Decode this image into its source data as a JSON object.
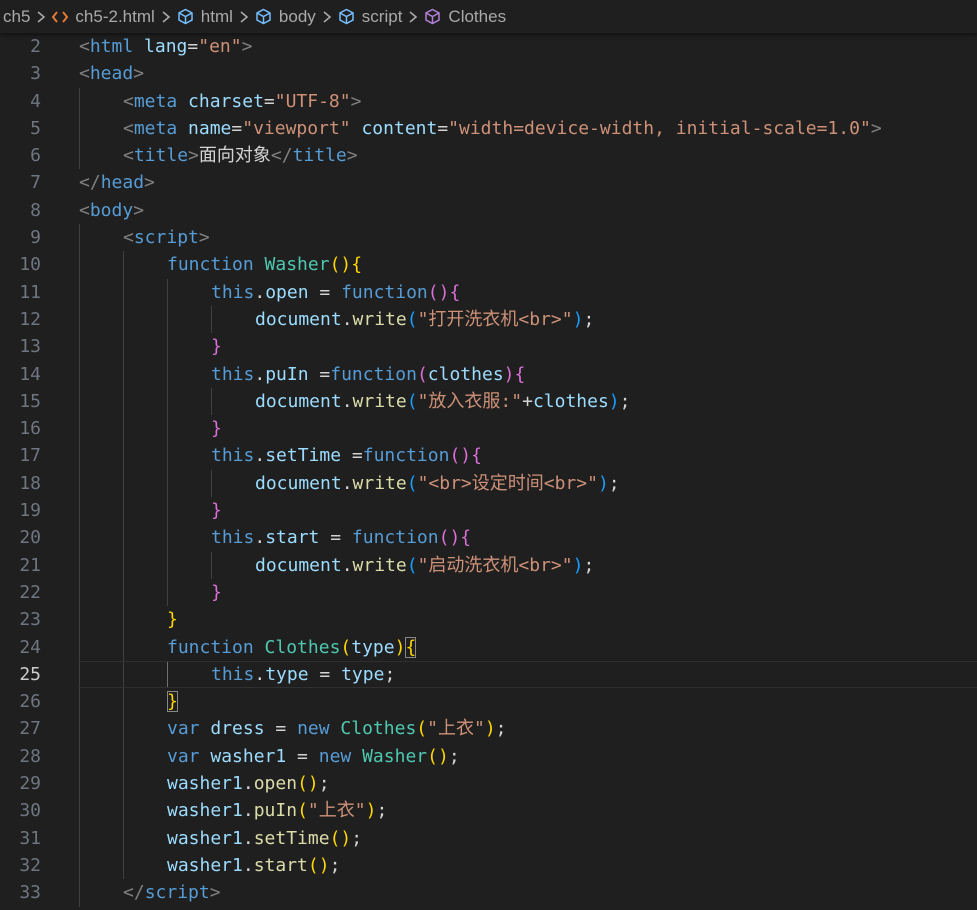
{
  "breadcrumb": {
    "items": [
      {
        "label": "ch5",
        "icon": "folder"
      },
      {
        "label": "ch5-2.html",
        "icon": "html-file-icon",
        "icon_color": "#e37933"
      },
      {
        "label": "html",
        "icon": "element-icon",
        "icon_color": "#75beff"
      },
      {
        "label": "body",
        "icon": "element-icon",
        "icon_color": "#75beff"
      },
      {
        "label": "script",
        "icon": "element-icon",
        "icon_color": "#75beff"
      },
      {
        "label": "Clothes",
        "icon": "class-icon",
        "icon_color": "#b180d7"
      }
    ],
    "separator_icon": "chevron-right-icon"
  },
  "editor": {
    "theme": "Dark Modern",
    "current_line": 25,
    "lines": [
      {
        "n": "2",
        "indent": 0,
        "tokens": [
          [
            "tag_punc",
            "<"
          ],
          [
            "tag",
            "html"
          ],
          [
            "text",
            " "
          ],
          [
            "attr",
            "lang"
          ],
          [
            "text",
            "="
          ],
          [
            "str",
            "\"en\""
          ],
          [
            "tag_punc",
            ">"
          ]
        ]
      },
      {
        "n": "3",
        "indent": 0,
        "tokens": [
          [
            "tag_punc",
            "<"
          ],
          [
            "tag",
            "head"
          ],
          [
            "tag_punc",
            ">"
          ]
        ]
      },
      {
        "n": "4",
        "indent": 1,
        "tokens": [
          [
            "tag_punc",
            "<"
          ],
          [
            "tag",
            "meta"
          ],
          [
            "text",
            " "
          ],
          [
            "attr",
            "charset"
          ],
          [
            "text",
            "="
          ],
          [
            "str",
            "\"UTF-8\""
          ],
          [
            "tag_punc",
            ">"
          ]
        ]
      },
      {
        "n": "5",
        "indent": 1,
        "tokens": [
          [
            "tag_punc",
            "<"
          ],
          [
            "tag",
            "meta"
          ],
          [
            "text",
            " "
          ],
          [
            "attr",
            "name"
          ],
          [
            "text",
            "="
          ],
          [
            "str",
            "\"viewport\""
          ],
          [
            "text",
            " "
          ],
          [
            "attr",
            "content"
          ],
          [
            "text",
            "="
          ],
          [
            "str",
            "\"width=device-width, initial-scale=1.0\""
          ],
          [
            "tag_punc",
            ">"
          ]
        ]
      },
      {
        "n": "6",
        "indent": 1,
        "tokens": [
          [
            "tag_punc",
            "<"
          ],
          [
            "tag",
            "title"
          ],
          [
            "tag_punc",
            ">"
          ],
          [
            "text",
            "面向对象"
          ],
          [
            "tag_punc",
            "</"
          ],
          [
            "tag",
            "title"
          ],
          [
            "tag_punc",
            ">"
          ]
        ]
      },
      {
        "n": "7",
        "indent": 0,
        "tokens": [
          [
            "tag_punc",
            "</"
          ],
          [
            "tag",
            "head"
          ],
          [
            "tag_punc",
            ">"
          ]
        ]
      },
      {
        "n": "8",
        "indent": 0,
        "tokens": [
          [
            "tag_punc",
            "<"
          ],
          [
            "tag",
            "body"
          ],
          [
            "tag_punc",
            ">"
          ]
        ]
      },
      {
        "n": "9",
        "indent": 1,
        "tokens": [
          [
            "tag_punc",
            "<"
          ],
          [
            "tag",
            "script"
          ],
          [
            "tag_punc",
            ">"
          ]
        ]
      },
      {
        "n": "10",
        "indent": 2,
        "tokens": [
          [
            "kw",
            "function"
          ],
          [
            "text",
            " "
          ],
          [
            "fn",
            "Washer"
          ],
          [
            "br1",
            "()"
          ],
          [
            "br1",
            "{"
          ]
        ]
      },
      {
        "n": "11",
        "indent": 3,
        "tokens": [
          [
            "kw",
            "this"
          ],
          [
            "text",
            "."
          ],
          [
            "var",
            "open"
          ],
          [
            "text",
            " = "
          ],
          [
            "kw",
            "function"
          ],
          [
            "br2",
            "()"
          ],
          [
            "br2",
            "{"
          ]
        ]
      },
      {
        "n": "12",
        "indent": 4,
        "tokens": [
          [
            "var",
            "document"
          ],
          [
            "text",
            "."
          ],
          [
            "call",
            "write"
          ],
          [
            "br3",
            "("
          ],
          [
            "str",
            "\"打开洗衣机<br>\""
          ],
          [
            "br3",
            ")"
          ],
          [
            "text",
            ";"
          ]
        ]
      },
      {
        "n": "13",
        "indent": 3,
        "tokens": [
          [
            "br2",
            "}"
          ]
        ]
      },
      {
        "n": "14",
        "indent": 3,
        "tokens": [
          [
            "kw",
            "this"
          ],
          [
            "text",
            "."
          ],
          [
            "var",
            "puIn"
          ],
          [
            "text",
            " ="
          ],
          [
            "kw",
            "function"
          ],
          [
            "br2",
            "("
          ],
          [
            "var",
            "clothes"
          ],
          [
            "br2",
            ")"
          ],
          [
            "br2",
            "{"
          ]
        ]
      },
      {
        "n": "15",
        "indent": 4,
        "tokens": [
          [
            "var",
            "document"
          ],
          [
            "text",
            "."
          ],
          [
            "call",
            "write"
          ],
          [
            "br3",
            "("
          ],
          [
            "str",
            "\"放入衣服:\""
          ],
          [
            "text",
            "+"
          ],
          [
            "var",
            "clothes"
          ],
          [
            "br3",
            ")"
          ],
          [
            "text",
            ";"
          ]
        ]
      },
      {
        "n": "16",
        "indent": 3,
        "tokens": [
          [
            "br2",
            "}"
          ]
        ]
      },
      {
        "n": "17",
        "indent": 3,
        "tokens": [
          [
            "kw",
            "this"
          ],
          [
            "text",
            "."
          ],
          [
            "var",
            "setTime"
          ],
          [
            "text",
            " ="
          ],
          [
            "kw",
            "function"
          ],
          [
            "br2",
            "()"
          ],
          [
            "br2",
            "{"
          ]
        ]
      },
      {
        "n": "18",
        "indent": 4,
        "tokens": [
          [
            "var",
            "document"
          ],
          [
            "text",
            "."
          ],
          [
            "call",
            "write"
          ],
          [
            "br3",
            "("
          ],
          [
            "str",
            "\"<br>设定时间<br>\""
          ],
          [
            "br3",
            ")"
          ],
          [
            "text",
            ";"
          ]
        ]
      },
      {
        "n": "19",
        "indent": 3,
        "tokens": [
          [
            "br2",
            "}"
          ]
        ]
      },
      {
        "n": "20",
        "indent": 3,
        "tokens": [
          [
            "kw",
            "this"
          ],
          [
            "text",
            "."
          ],
          [
            "var",
            "start"
          ],
          [
            "text",
            " = "
          ],
          [
            "kw",
            "function"
          ],
          [
            "br2",
            "()"
          ],
          [
            "br2",
            "{"
          ]
        ]
      },
      {
        "n": "21",
        "indent": 4,
        "tokens": [
          [
            "var",
            "document"
          ],
          [
            "text",
            "."
          ],
          [
            "call",
            "write"
          ],
          [
            "br3",
            "("
          ],
          [
            "str",
            "\"启动洗衣机<br>\""
          ],
          [
            "br3",
            ")"
          ],
          [
            "text",
            ";"
          ]
        ]
      },
      {
        "n": "22",
        "indent": 3,
        "tokens": [
          [
            "br2",
            "}"
          ]
        ]
      },
      {
        "n": "23",
        "indent": 2,
        "tokens": [
          [
            "br1",
            "}"
          ]
        ]
      },
      {
        "n": "24",
        "indent": 2,
        "tokens": [
          [
            "kw",
            "function"
          ],
          [
            "text",
            " "
          ],
          [
            "fn",
            "Clothes"
          ],
          [
            "br1",
            "("
          ],
          [
            "var",
            "type"
          ],
          [
            "br1",
            ")"
          ],
          [
            "br1_match",
            "{"
          ]
        ]
      },
      {
        "n": "25",
        "indent": 3,
        "tokens": [
          [
            "kw",
            "this"
          ],
          [
            "text",
            "."
          ],
          [
            "var",
            "type"
          ],
          [
            "text",
            " = "
          ],
          [
            "var",
            "type"
          ],
          [
            "text",
            ";"
          ]
        ]
      },
      {
        "n": "26",
        "indent": 2,
        "tokens": [
          [
            "br1_match",
            "}"
          ]
        ]
      },
      {
        "n": "27",
        "indent": 2,
        "tokens": [
          [
            "kw",
            "var"
          ],
          [
            "text",
            " "
          ],
          [
            "var",
            "dress"
          ],
          [
            "text",
            " = "
          ],
          [
            "kw",
            "new"
          ],
          [
            "text",
            " "
          ],
          [
            "fn",
            "Clothes"
          ],
          [
            "br1",
            "("
          ],
          [
            "str",
            "\"上衣\""
          ],
          [
            "br1",
            ")"
          ],
          [
            "text",
            ";"
          ]
        ]
      },
      {
        "n": "28",
        "indent": 2,
        "tokens": [
          [
            "kw",
            "var"
          ],
          [
            "text",
            " "
          ],
          [
            "var",
            "washer1"
          ],
          [
            "text",
            " = "
          ],
          [
            "kw",
            "new"
          ],
          [
            "text",
            " "
          ],
          [
            "fn",
            "Washer"
          ],
          [
            "br1",
            "()"
          ],
          [
            "text",
            ";"
          ]
        ]
      },
      {
        "n": "29",
        "indent": 2,
        "tokens": [
          [
            "var",
            "washer1"
          ],
          [
            "text",
            "."
          ],
          [
            "call",
            "open"
          ],
          [
            "br1",
            "()"
          ],
          [
            "text",
            ";"
          ]
        ]
      },
      {
        "n": "30",
        "indent": 2,
        "tokens": [
          [
            "var",
            "washer1"
          ],
          [
            "text",
            "."
          ],
          [
            "call",
            "puIn"
          ],
          [
            "br1",
            "("
          ],
          [
            "str",
            "\"上衣\""
          ],
          [
            "br1",
            ")"
          ],
          [
            "text",
            ";"
          ]
        ]
      },
      {
        "n": "31",
        "indent": 2,
        "tokens": [
          [
            "var",
            "washer1"
          ],
          [
            "text",
            "."
          ],
          [
            "call",
            "setTime"
          ],
          [
            "br1",
            "()"
          ],
          [
            "text",
            ";"
          ]
        ]
      },
      {
        "n": "32",
        "indent": 2,
        "tokens": [
          [
            "var",
            "washer1"
          ],
          [
            "text",
            "."
          ],
          [
            "call",
            "start"
          ],
          [
            "br1",
            "()"
          ],
          [
            "text",
            ";"
          ]
        ]
      },
      {
        "n": "33",
        "indent": 1,
        "tokens": [
          [
            "tag_punc",
            "</"
          ],
          [
            "tag",
            "script"
          ],
          [
            "tag_punc",
            ">"
          ]
        ]
      }
    ]
  }
}
